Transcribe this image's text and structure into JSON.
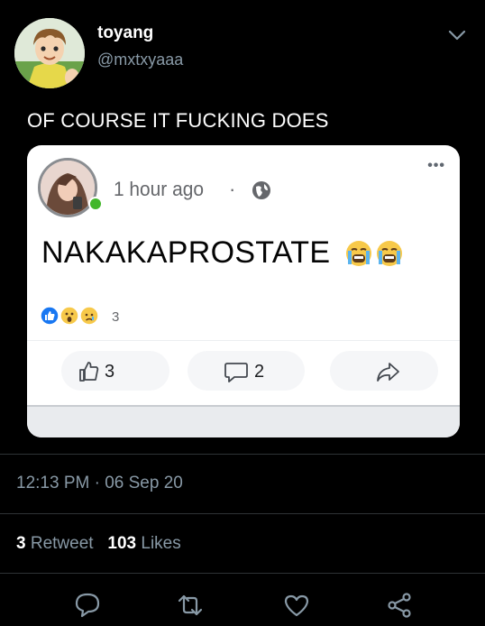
{
  "tweet": {
    "author_name": "toyang",
    "author_handle": "@mxtxyaaa",
    "text": "OF COURSE IT FUCKING DOES",
    "timestamp": "12:13 PM · 06 Sep 20",
    "retweet_count": "3",
    "retweet_label": "Retweet",
    "like_count": "103",
    "like_label": "Likes"
  },
  "embedded_post": {
    "more_icon": "more-horizontal-icon",
    "time": "1 hour ago",
    "separator": "·",
    "privacy_icon": "globe-icon",
    "text": "NAKAKAPROSTATE",
    "emoji": [
      "loudly-crying-face",
      "loudly-crying-face"
    ],
    "reactions": [
      "like",
      "wow",
      "sad"
    ],
    "reaction_count": "3",
    "like_count": "3",
    "comment_count": "2"
  },
  "actions": [
    "reply-icon",
    "retweet-icon",
    "like-icon",
    "share-icon"
  ],
  "colors": {
    "background": "#000000",
    "secondary_text": "#8899a6",
    "divider": "#2f3336",
    "facebook_blue": "#1877f2",
    "reaction_yellow": "#f7c94a"
  }
}
